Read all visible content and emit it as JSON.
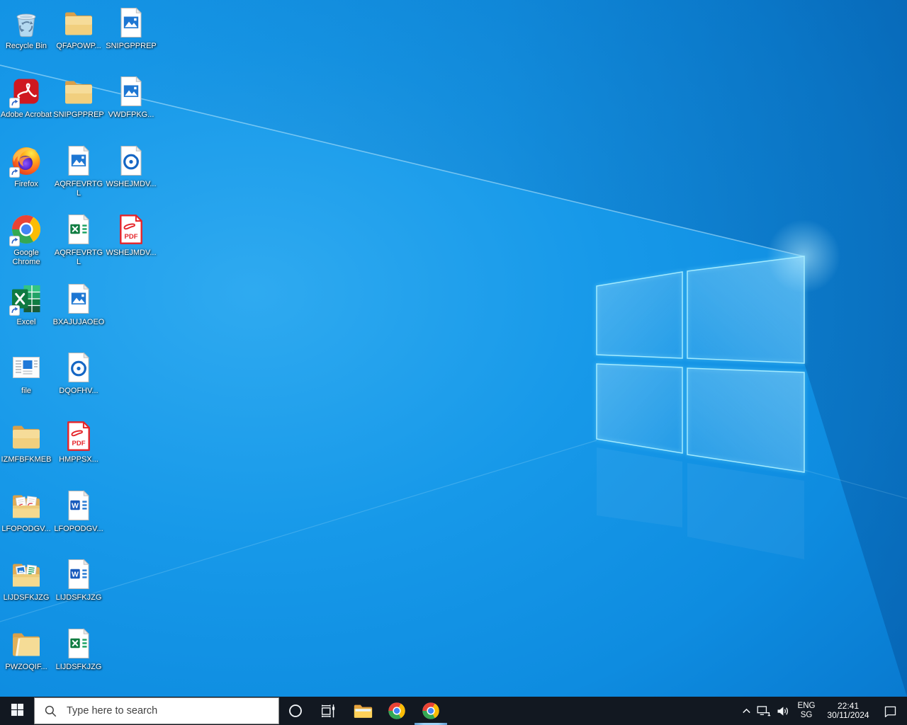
{
  "desktop": {
    "icons": [
      {
        "label": "Recycle Bin",
        "type": "recycle-bin",
        "col": 0,
        "row": 0,
        "shortcut": false
      },
      {
        "label": "QFAPOWP...",
        "type": "folder",
        "col": 1,
        "row": 0,
        "shortcut": false
      },
      {
        "label": "SNIPGPPREP",
        "type": "image-file",
        "col": 2,
        "row": 0,
        "shortcut": false
      },
      {
        "label": "Adobe Acrobat",
        "type": "acrobat-app",
        "col": 0,
        "row": 1,
        "shortcut": true
      },
      {
        "label": "SNIPGPPREP",
        "type": "folder",
        "col": 1,
        "row": 1,
        "shortcut": false
      },
      {
        "label": "VWDFPKG...",
        "type": "image-file",
        "col": 2,
        "row": 1,
        "shortcut": false
      },
      {
        "label": "Firefox",
        "type": "firefox-app",
        "col": 0,
        "row": 2,
        "shortcut": true
      },
      {
        "label": "AQRFEVRTGL",
        "type": "image-file",
        "col": 1,
        "row": 2,
        "shortcut": false
      },
      {
        "label": "WSHEJMDV...",
        "type": "media-file",
        "col": 2,
        "row": 2,
        "shortcut": false
      },
      {
        "label": "Google Chrome",
        "type": "chrome-app",
        "col": 0,
        "row": 3,
        "shortcut": true
      },
      {
        "label": "AQRFEVRTGL",
        "type": "excel-file",
        "col": 1,
        "row": 3,
        "shortcut": false
      },
      {
        "label": "WSHEJMDV...",
        "type": "pdf-file",
        "col": 2,
        "row": 3,
        "shortcut": false
      },
      {
        "label": "Excel",
        "type": "excel-app",
        "col": 0,
        "row": 4,
        "shortcut": true
      },
      {
        "label": "BXAJUJAOEO",
        "type": "image-file",
        "col": 1,
        "row": 4,
        "shortcut": false
      },
      {
        "label": "file",
        "type": "window-file",
        "col": 0,
        "row": 5,
        "shortcut": false
      },
      {
        "label": "DQOFHV...",
        "type": "media-file",
        "col": 1,
        "row": 5,
        "shortcut": false
      },
      {
        "label": "IZMFBFKMEB",
        "type": "folder",
        "col": 0,
        "row": 6,
        "shortcut": false
      },
      {
        "label": "HMPPSX...",
        "type": "pdf-file",
        "col": 1,
        "row": 6,
        "shortcut": false
      },
      {
        "label": "LFOPODGV...",
        "type": "folder-docs-pdf",
        "col": 0,
        "row": 7,
        "shortcut": false
      },
      {
        "label": "LFOPODGV...",
        "type": "word-file",
        "col": 1,
        "row": 7,
        "shortcut": false
      },
      {
        "label": "LIJDSFKJZG",
        "type": "folder-docs-media",
        "col": 0,
        "row": 8,
        "shortcut": false
      },
      {
        "label": "LIJDSFKJZG",
        "type": "word-file",
        "col": 1,
        "row": 8,
        "shortcut": false
      },
      {
        "label": "PWZOQIF...",
        "type": "folder-paper",
        "col": 0,
        "row": 9,
        "shortcut": false
      },
      {
        "label": "LIJDSFKJZG",
        "type": "excel-file",
        "col": 1,
        "row": 9,
        "shortcut": false
      }
    ]
  },
  "taskbar": {
    "search_placeholder": "Type here to search",
    "tray": {
      "language_primary": "ENG",
      "language_region": "SG",
      "time": "22:41",
      "date": "30/11/2024"
    }
  },
  "colors": {
    "accent": "#0078D7",
    "taskbar_bg": "#121821",
    "wallpaper_azure": "#1799E9",
    "folder_yellow": "#F1CF7E",
    "pdf_red": "#E5252A",
    "excel_green": "#107C41",
    "word_blue": "#185ABD",
    "image_blue": "#1E77D3",
    "running_indicator": "#9FD2F6"
  }
}
